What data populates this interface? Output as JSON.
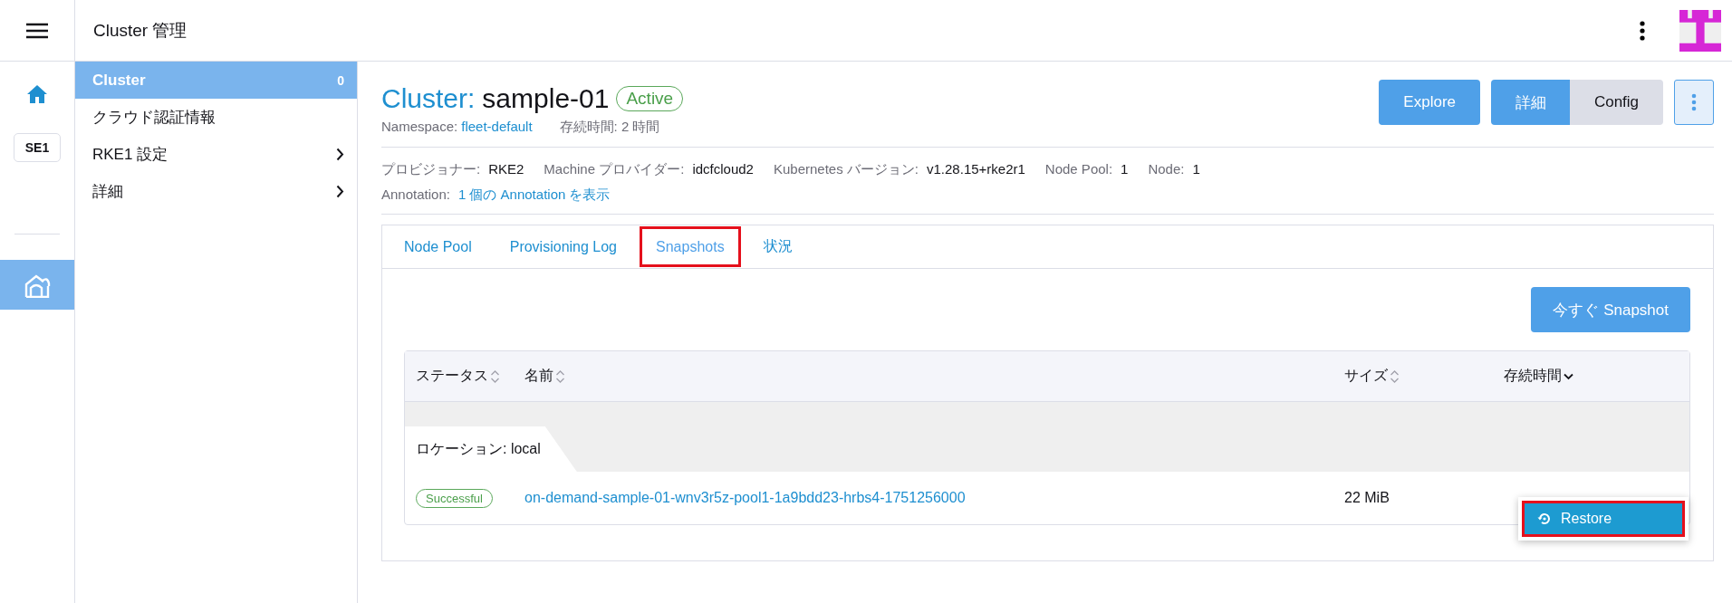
{
  "header": {
    "title": "Cluster 管理"
  },
  "rail": {
    "items": [
      {
        "kind": "home",
        "selected": false
      },
      {
        "kind": "badge",
        "label": "SE1",
        "selected": false
      },
      {
        "kind": "cluster",
        "selected": true
      }
    ]
  },
  "sidebar": {
    "items": [
      {
        "label": "Cluster",
        "count": "0",
        "selected": true,
        "expandable": false
      },
      {
        "label": "クラウド認証情報",
        "selected": false,
        "expandable": false
      },
      {
        "label": "RKE1 設定",
        "selected": false,
        "expandable": true
      },
      {
        "label": "詳細",
        "selected": false,
        "expandable": true
      }
    ]
  },
  "title": {
    "prefix": "Cluster:",
    "name": "sample-01",
    "status": "Active"
  },
  "subtitle": {
    "namespace_label": "Namespace:",
    "namespace": "fleet-default",
    "age": "存続時間: 2 時間"
  },
  "actions": {
    "explore": "Explore",
    "views": [
      {
        "label": "詳細",
        "selected": true
      },
      {
        "label": "Config",
        "selected": false
      }
    ]
  },
  "meta": [
    {
      "label": "プロビジョナー:",
      "value": "RKE2"
    },
    {
      "label": "Machine プロバイダー:",
      "value": "idcfcloud2"
    },
    {
      "label": "Kubernetes バージョン:",
      "value": "v1.28.15+rke2r1"
    },
    {
      "label": "Node Pool:",
      "value": "1"
    },
    {
      "label": "Node:",
      "value": "1"
    }
  ],
  "annotation": {
    "label": "Annotation:",
    "link": "1 個の Annotation を表示"
  },
  "tabs": [
    {
      "label": "Node Pool",
      "selected": false,
      "highlighted": false
    },
    {
      "label": "Provisioning Log",
      "selected": false,
      "highlighted": false
    },
    {
      "label": "Snapshots",
      "selected": true,
      "highlighted": true
    },
    {
      "label": "状況",
      "selected": false,
      "highlighted": false
    }
  ],
  "snapshot_button": "今すぐ Snapshot",
  "table": {
    "columns": [
      {
        "label": "ステータス",
        "sorted": false
      },
      {
        "label": "名前",
        "sorted": false
      },
      {
        "label": "サイズ",
        "sorted": false
      },
      {
        "label": "存続時間",
        "sorted": true
      }
    ],
    "group": "ロケーション: local",
    "rows": [
      {
        "status": "Successful",
        "name": "on-demand-sample-01-wnv3r5z-pool1-1a9bdd23-hrbs4-1751256000",
        "size": "22 MiB"
      }
    ]
  },
  "menu": {
    "items": [
      {
        "label": "Restore",
        "highlighted": true
      }
    ]
  }
}
